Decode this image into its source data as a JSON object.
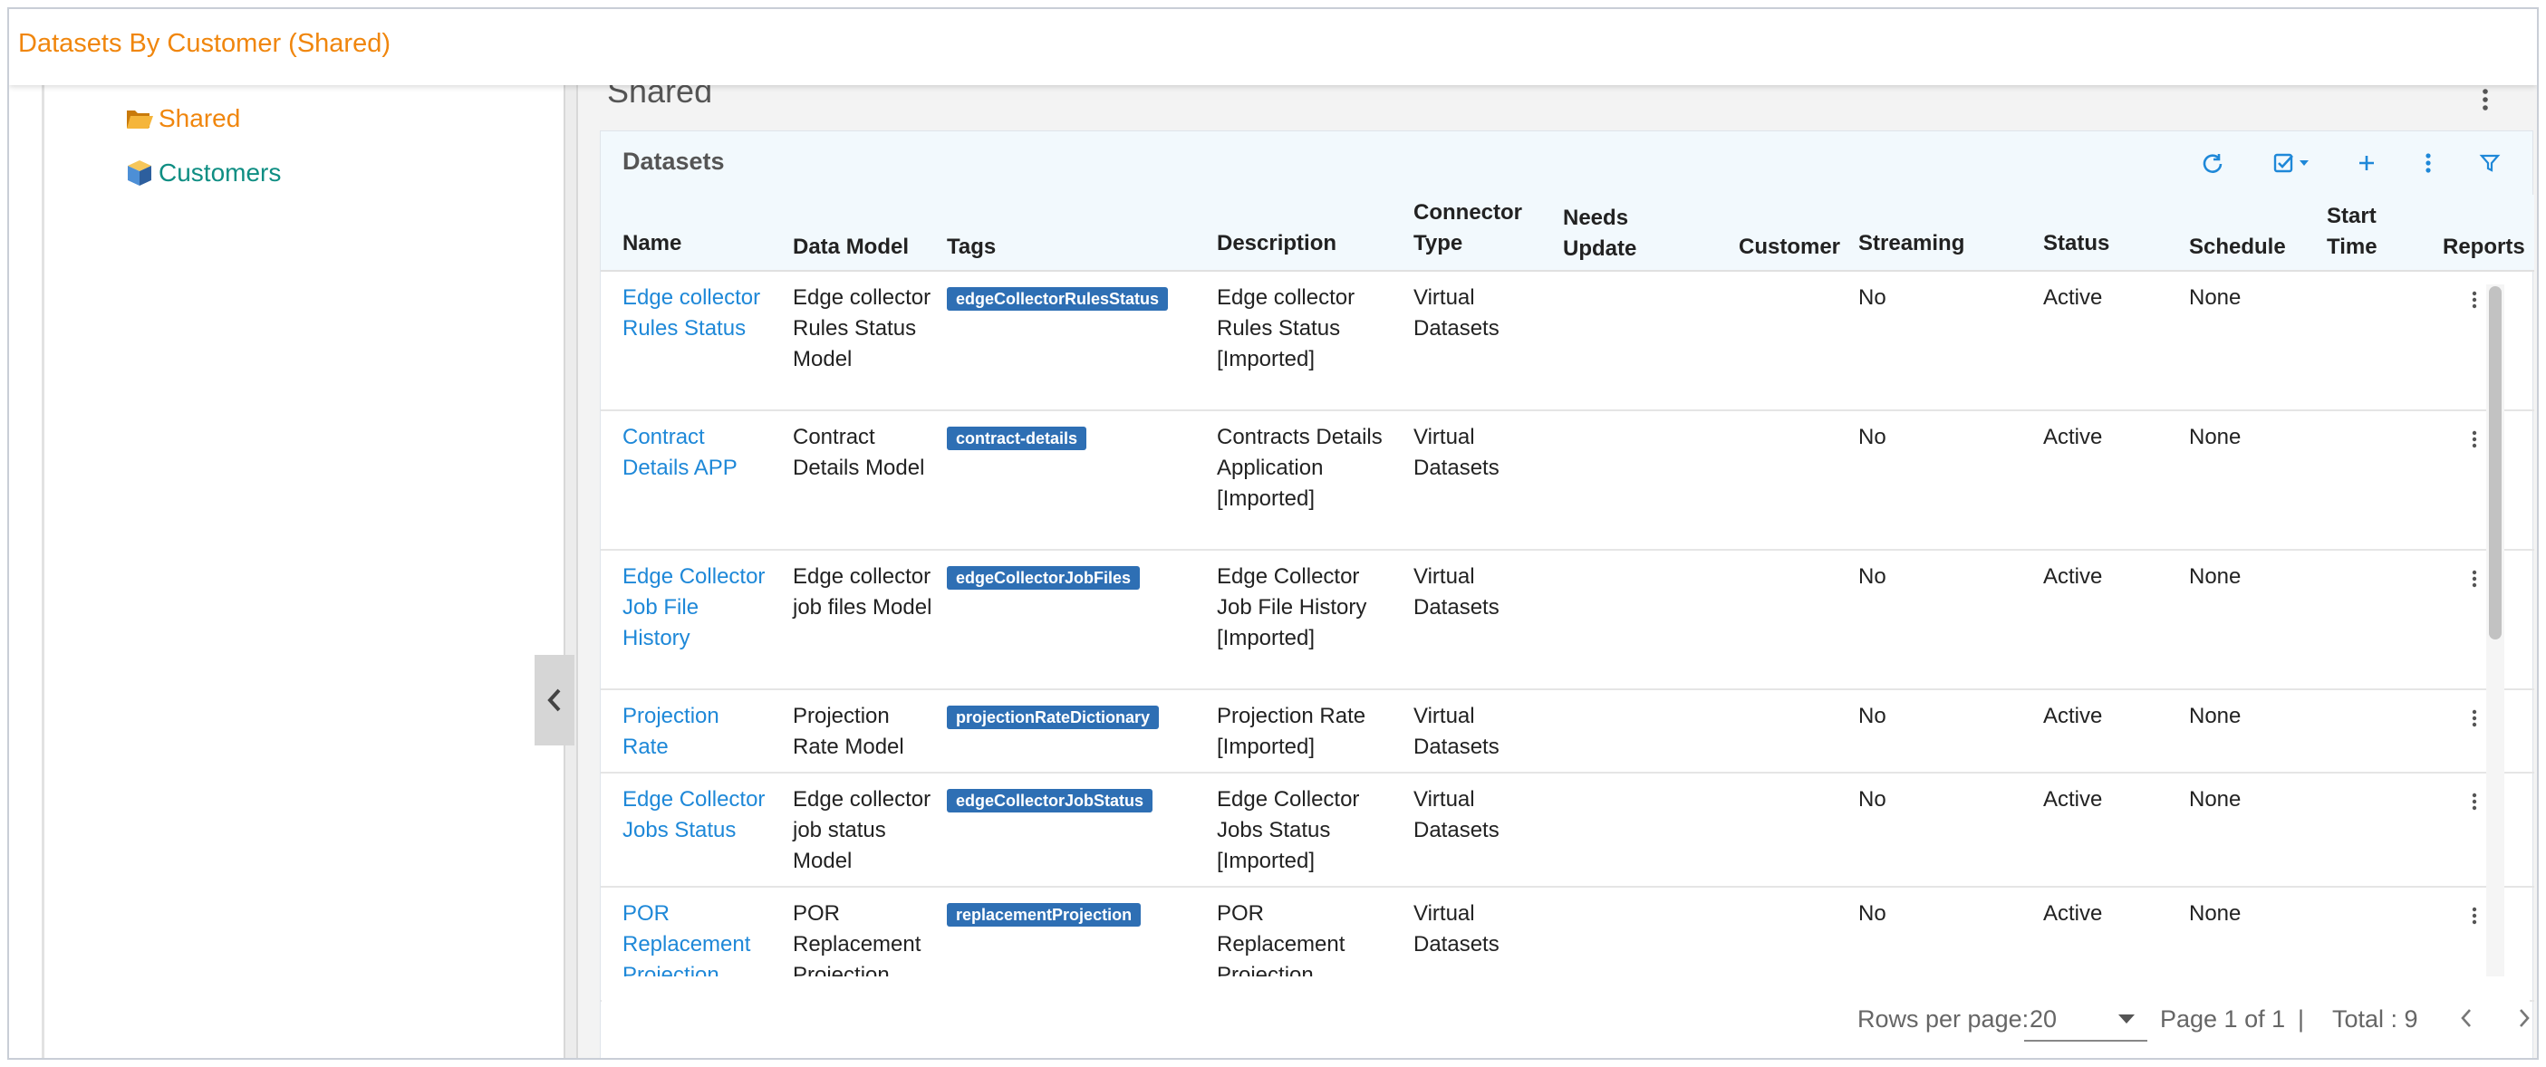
{
  "header": {
    "title": "Datasets By Customer (Shared)"
  },
  "tree": {
    "shared_label": "Shared",
    "customers_label": "Customers"
  },
  "section": {
    "title": "Shared"
  },
  "card": {
    "title": "Datasets"
  },
  "columns": [
    "Name",
    "Data Model",
    "Tags",
    "Description",
    "Connector Type",
    "Needs Update",
    "Customer",
    "Streaming",
    "Status",
    "Schedule",
    "Start Time",
    "Reports"
  ],
  "rows": [
    {
      "name": "Edge collector Rules Status",
      "data_model": "Edge collector Rules Status Model",
      "tag": "edgeCollectorRulesStatus",
      "description": "Edge collector Rules Status [Imported]",
      "connector_type": "Virtual Datasets",
      "needs_update": "",
      "customer": "",
      "streaming": "No",
      "status": "Active",
      "schedule": "None",
      "start_time": ""
    },
    {
      "name": "Contract Details APP",
      "data_model": "Contract Details Model",
      "tag": "contract-details",
      "description": "Contracts Details Application [Imported]",
      "connector_type": "Virtual Datasets",
      "needs_update": "",
      "customer": "",
      "streaming": "No",
      "status": "Active",
      "schedule": "None",
      "start_time": ""
    },
    {
      "name": "Edge Collector Job File History",
      "data_model": "Edge collector job files Model",
      "tag": "edgeCollectorJobFiles",
      "description": "Edge Collector Job File History [Imported]",
      "connector_type": "Virtual Datasets",
      "needs_update": "",
      "customer": "",
      "streaming": "No",
      "status": "Active",
      "schedule": "None",
      "start_time": ""
    },
    {
      "name": "Projection Rate",
      "data_model": "Projection Rate Model",
      "tag": "projectionRateDictionary",
      "description": "Projection Rate [Imported]",
      "connector_type": "Virtual Datasets",
      "needs_update": "",
      "customer": "",
      "streaming": "No",
      "status": "Active",
      "schedule": "None",
      "start_time": ""
    },
    {
      "name": "Edge Collector Jobs Status",
      "data_model": "Edge collector job status Model",
      "tag": "edgeCollectorJobStatus",
      "description": "Edge Collector Jobs Status [Imported]",
      "connector_type": "Virtual Datasets",
      "needs_update": "",
      "customer": "",
      "streaming": "No",
      "status": "Active",
      "schedule": "None",
      "start_time": ""
    },
    {
      "name": "POR Replacement Projection",
      "data_model": "POR Replacement Projection",
      "tag": "replacementProjection",
      "description": "POR Replacement Projection",
      "connector_type": "Virtual Datasets",
      "needs_update": "",
      "customer": "",
      "streaming": "No",
      "status": "Active",
      "schedule": "None",
      "start_time": ""
    }
  ],
  "pagination": {
    "rows_per_page_label": "Rows per page:",
    "rows_per_page": "20",
    "page_info": "Page 1 of 1",
    "separator": "|",
    "total": "Total : 9"
  },
  "icons": {
    "refresh": "refresh-icon",
    "bulk": "checklist-icon",
    "add": "plus-icon",
    "more": "more-vert-icon",
    "filter": "filter-icon"
  },
  "colors": {
    "accent_orange": "#f0860d",
    "teal": "#0f8e83",
    "link_blue": "#1e88d8",
    "tag_blue": "#2e6fb4"
  }
}
